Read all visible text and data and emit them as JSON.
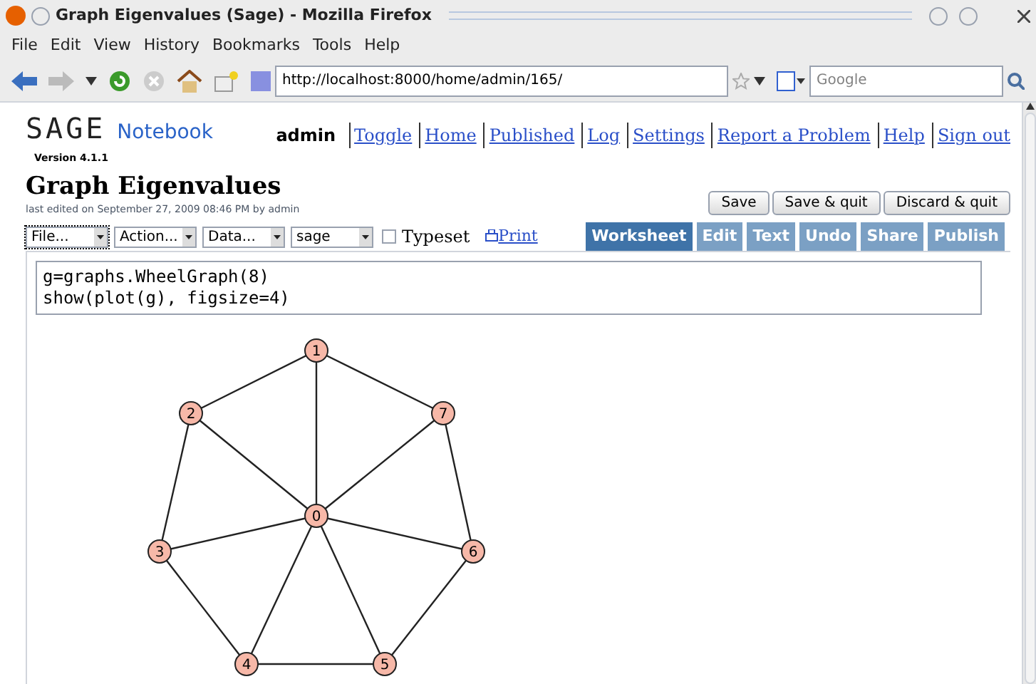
{
  "window": {
    "title": "Graph Eigenvalues (Sage) - Mozilla Firefox"
  },
  "menu": [
    "File",
    "Edit",
    "View",
    "History",
    "Bookmarks",
    "Tools",
    "Help"
  ],
  "address": {
    "value": "http://localhost:8000/home/admin/165/"
  },
  "search": {
    "placeholder": "Google"
  },
  "sage": {
    "logo": "SAGE",
    "product": "Notebook",
    "version": "Version 4.1.1",
    "user": "admin",
    "links": [
      "Toggle",
      "Home",
      "Published",
      "Log",
      "Settings",
      "Report a Problem",
      "Help",
      "Sign out"
    ]
  },
  "worksheet": {
    "title": "Graph Eigenvalues",
    "edited": "last edited on September 27, 2009 08:46 PM by admin",
    "buttons": [
      "Save",
      "Save & quit",
      "Discard & quit"
    ],
    "dropdowns": [
      "File...",
      "Action...",
      "Data...",
      "sage"
    ],
    "typeset": {
      "label": "Typeset",
      "checked": false
    },
    "print": "Print",
    "tabs": [
      {
        "label": "Worksheet",
        "selected": true
      },
      {
        "label": "Edit",
        "selected": false
      },
      {
        "label": "Text",
        "selected": false
      },
      {
        "label": "Undo",
        "selected": false
      },
      {
        "label": "Share",
        "selected": false
      },
      {
        "label": "Publish",
        "selected": false
      }
    ]
  },
  "cell": {
    "lines": [
      "g=graphs.WheelGraph(8)",
      "show(plot(g), figsize=4)"
    ]
  },
  "graph": {
    "nodes": [
      "0",
      "1",
      "2",
      "3",
      "4",
      "5",
      "6",
      "7"
    ]
  }
}
